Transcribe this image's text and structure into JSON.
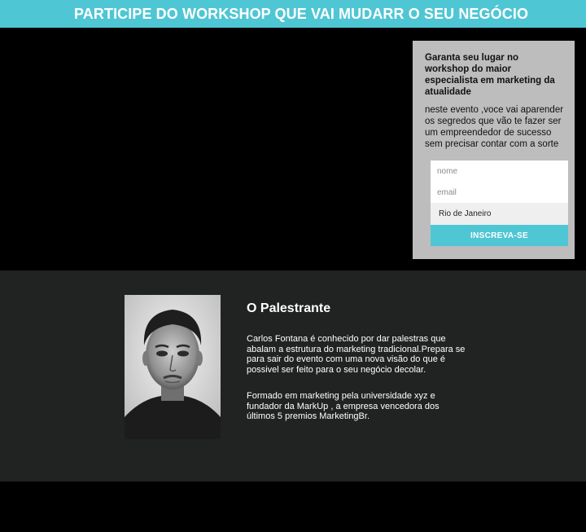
{
  "banner": {
    "title": "PARTICIPE DO WORKSHOP QUE VAI MUDARR O SEU NEGÓCIO"
  },
  "signup": {
    "headline": "Garanta seu lugar no workshop do maior especialista em marketing da atualidade",
    "description": "neste evento ,voce vai aparender os segredos que vão te fazer ser um empreendedor de sucesso sem precisar contar com a sorte",
    "name_placeholder": "nome",
    "email_placeholder": "email",
    "city_value": "Rio de Janeiro",
    "submit_label": "INSCREVA-SE"
  },
  "speaker": {
    "heading": "O Palestrante",
    "bio_1": "Carlos Fontana é conhecido por dar palestras que abalam a estrutura do marketing tradicional.Prepara se para sair do evento com uma nova visão do que é possivel ser feito para o seu negócio decolar.",
    "bio_2": "Formado em marketing pela universidade xyz e fundador da MarkUp , a empresa vencedora dos últimos 5 premios MarketingBr."
  },
  "colors": {
    "accent": "#4fc6d4",
    "card_bg": "#bdbdbd",
    "section_bg": "#212323",
    "page_bg": "#000000"
  }
}
